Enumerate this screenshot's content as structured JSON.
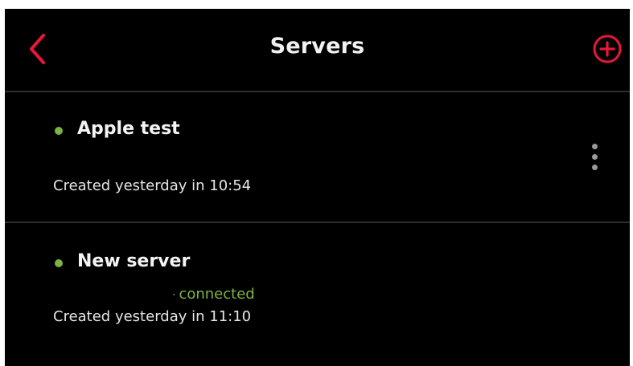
{
  "header": {
    "title": "Servers",
    "back_icon": "chevron-left-icon",
    "add_icon": "plus-circle-icon",
    "accent_color": "#e8173a"
  },
  "servers": [
    {
      "name": "Apple test",
      "created": "Created yesterday in 10:54",
      "status_color": "#7cb342",
      "status_text": "",
      "menu_icon": "more-vertical-icon"
    },
    {
      "name": "New server",
      "created": "Created yesterday in 11:10",
      "status_color": "#7cb342",
      "status_text": "connected"
    }
  ]
}
